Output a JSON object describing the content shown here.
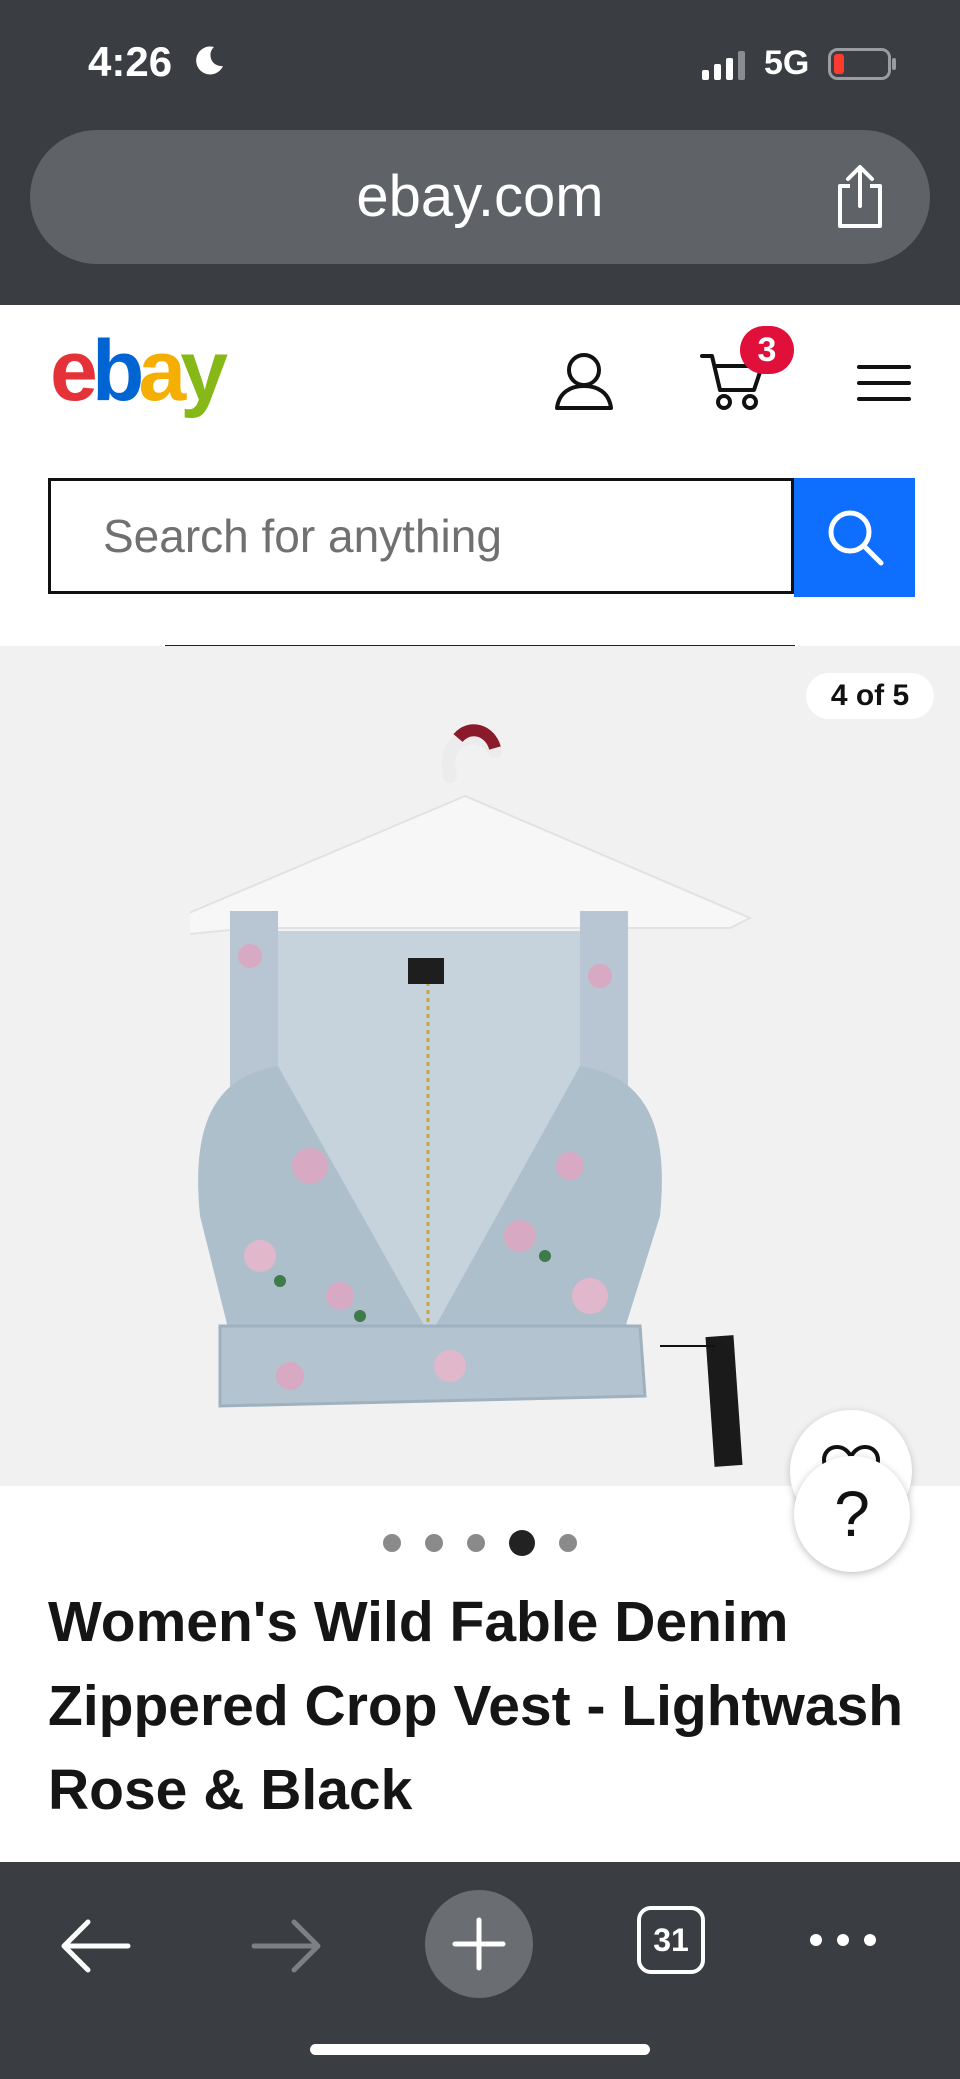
{
  "status_bar": {
    "time": "4:26",
    "network": "5G"
  },
  "browser": {
    "url": "ebay.com",
    "tab_count": "31"
  },
  "header": {
    "cart_count": "3"
  },
  "search": {
    "placeholder": "Search for anything"
  },
  "gallery": {
    "counter": "4 of 5",
    "current_index": 4,
    "total": 5
  },
  "product": {
    "title": "Women's Wild Fable Denim Zippered Crop Vest - Lightwash Rose & Black"
  },
  "help_button": {
    "label": "?"
  },
  "icons": {
    "moon": "moon-icon",
    "signal": "signal-icon",
    "battery": "battery-icon",
    "share": "share-icon",
    "account": "account-icon",
    "cart": "cart-icon",
    "menu": "menu-icon",
    "search": "search-icon",
    "watch": "heart-icon",
    "back": "back-arrow-icon",
    "forward": "forward-arrow-icon",
    "new_tab": "plus-icon",
    "more": "more-icon"
  },
  "colors": {
    "ebay_blue": "#0e6efe",
    "badge_red": "#e0103a",
    "chrome_dark": "#3a3d41"
  }
}
